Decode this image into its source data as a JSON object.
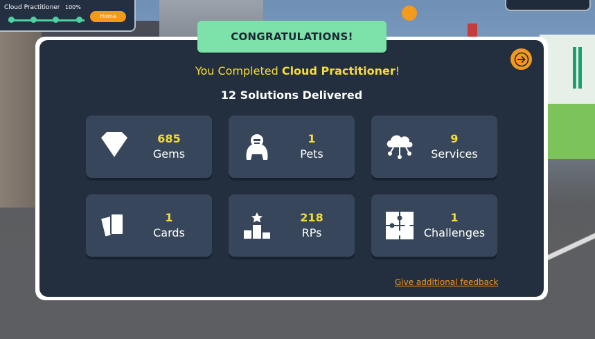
{
  "hud": {
    "title": "Cloud Practitioner",
    "percent": "100%",
    "button": "Home"
  },
  "dialog": {
    "banner": "CONGRATULATIONS!",
    "completed_prefix": "You Completed ",
    "completed_name": "Cloud Practitioner",
    "completed_suffix": "!",
    "solutions": "12 Solutions Delivered",
    "feedback_link": "Give additional feedback"
  },
  "stats": [
    {
      "value": "685",
      "label": "Gems",
      "icon": "gem-icon"
    },
    {
      "value": "1",
      "label": "Pets",
      "icon": "gorilla-icon"
    },
    {
      "value": "9",
      "label": "Services",
      "icon": "cloud-network-icon"
    },
    {
      "value": "1",
      "label": "Cards",
      "icon": "cards-icon"
    },
    {
      "value": "218",
      "label": "RPs",
      "icon": "podium-icon"
    },
    {
      "value": "1",
      "label": "Challenges",
      "icon": "puzzle-icon"
    }
  ],
  "colors": {
    "panel": "#232f3e",
    "card": "#37465a",
    "banner": "#7ce2a9",
    "accent_yellow": "#f4dd3a",
    "accent_orange": "#f39a1c"
  }
}
